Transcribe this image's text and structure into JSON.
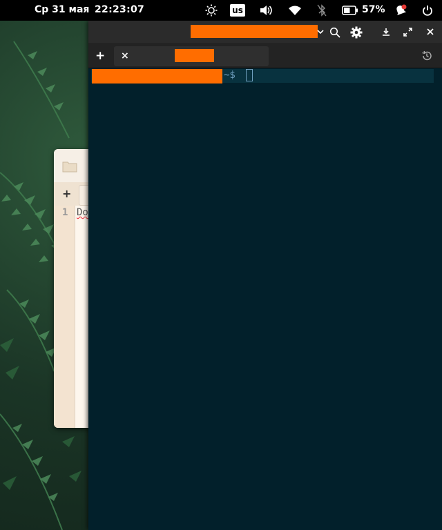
{
  "topbar": {
    "date": "Ср 31 мая",
    "time": "22:23:07",
    "keyboard_layout": "us",
    "battery_percent": "57%",
    "battery_level": 0.57,
    "notification_dot_color": "#e53935"
  },
  "editor": {
    "line_number": "1",
    "visible_text": "Do"
  },
  "terminal": {
    "prompt_suffix": "~$",
    "redaction_color": "#ff6d00",
    "background_color": "#02202b"
  },
  "icons": {
    "night_light": "sun-icon",
    "volume": "volume-icon",
    "wifi": "wifi-icon",
    "bluetooth_off": "bluetooth-off-icon",
    "battery": "battery-icon",
    "notifications": "bell-icon",
    "power": "power-icon",
    "search": "search-icon",
    "settings": "gear-icon",
    "download": "download-icon",
    "maximize": "maximize-icon",
    "close": "close-icon",
    "history": "history-icon",
    "new_tab": "plus-icon",
    "folder": "folder-icon"
  }
}
